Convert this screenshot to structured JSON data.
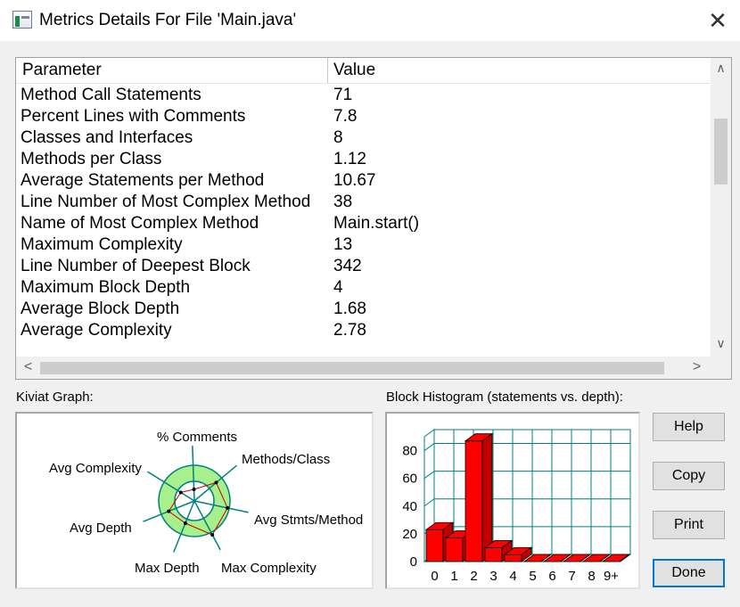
{
  "window": {
    "title": "Metrics Details For File 'Main.java'",
    "close_icon": "close-icon"
  },
  "table": {
    "columns": [
      "Parameter",
      "Value"
    ],
    "rows": [
      {
        "parameter": "Method Call Statements",
        "value": "71"
      },
      {
        "parameter": "Percent Lines with Comments",
        "value": "7.8"
      },
      {
        "parameter": "Classes and Interfaces",
        "value": "8"
      },
      {
        "parameter": "Methods per Class",
        "value": "1.12"
      },
      {
        "parameter": "Average Statements per Method",
        "value": "10.67"
      },
      {
        "parameter": "Line Number of Most Complex Method",
        "value": "38"
      },
      {
        "parameter": "Name of Most Complex Method",
        "value": "Main.start()"
      },
      {
        "parameter": "Maximum Complexity",
        "value": "13"
      },
      {
        "parameter": "Line Number of Deepest Block",
        "value": "342"
      },
      {
        "parameter": "Maximum Block Depth",
        "value": "4"
      },
      {
        "parameter": "Average Block Depth",
        "value": "1.68"
      },
      {
        "parameter": "Average Complexity",
        "value": "2.78"
      }
    ]
  },
  "kiviat": {
    "label": "Kiviat Graph:",
    "axes": [
      "% Comments",
      "Methods/Class",
      "Avg Stmts/Method",
      "Max Complexity",
      "Max Depth",
      "Avg Depth",
      "Avg Complexity"
    ],
    "colors": {
      "band": "#a8f08c",
      "axis": "#00807f",
      "polygon": "#cc0000"
    }
  },
  "chart_data": {
    "type": "bar",
    "title": "Block Histogram (statements vs. depth):",
    "categories": [
      "0",
      "1",
      "2",
      "3",
      "4",
      "5",
      "6",
      "7",
      "8",
      "9+"
    ],
    "values": [
      23,
      17,
      87,
      10,
      5,
      0,
      0,
      0,
      0,
      0
    ],
    "ylim": [
      0,
      90
    ],
    "yticks": [
      "0",
      "20",
      "40",
      "60",
      "80"
    ],
    "grid": true,
    "colors": {
      "bar": "#ff0000",
      "grid": "#00807f"
    }
  },
  "buttons": {
    "help": "Help",
    "copy": "Copy",
    "print": "Print",
    "done": "Done"
  }
}
